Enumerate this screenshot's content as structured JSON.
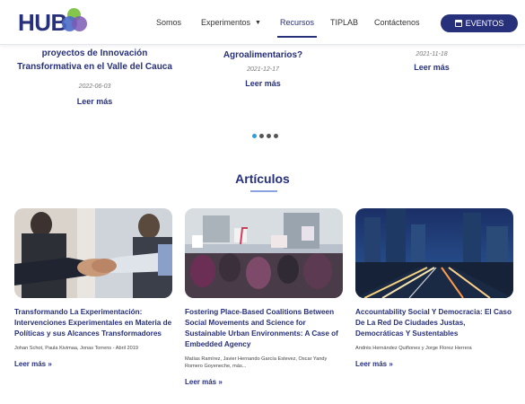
{
  "header": {
    "logo_text": "HUB",
    "nav": [
      {
        "label": "Somos"
      },
      {
        "label": "Experimentos"
      },
      {
        "label": "Recursos"
      },
      {
        "label": "TIPLAB"
      },
      {
        "label": "Contáctenos"
      }
    ],
    "active_nav": "Recursos",
    "events_button": "EVENTOS",
    "colors": {
      "brand": "#27307a",
      "active_dot": "#2e9fd8"
    }
  },
  "carousel": {
    "slides": [
      {
        "title_line1": "proyectos de Innovación",
        "title_line2": "Transformativa en el Valle del Cauca",
        "date": "2022-06-03",
        "more": "Leer más"
      },
      {
        "title_line1": "Agroalimentarios?",
        "date": "2021-12-17",
        "more": "Leer más"
      },
      {
        "date": "2021-11-18",
        "more": "Leer más"
      }
    ],
    "dots": 4,
    "active_dot": 1
  },
  "section": {
    "title": "Artículos"
  },
  "articles": [
    {
      "title": "Transformando La Experimentación: Intervenciones Experimentales en Materia de Políticas y sus Alcances Transformadores",
      "authors": "Johan Schot, Paula Kivimaa, Jonas Torrens - Abril 2019",
      "more": "Leer más »",
      "image": "handshake-photo"
    },
    {
      "title": "Fostering Place-Based Coalitions Between Social Movements and Science for Sustainable Urban Environments: A Case of Embedded Agency",
      "authors": "Matías Ramírez, Javier Hernando García Estevez, Oscar Yandy Romero Goyeneche, más...",
      "more": "Leer más »",
      "image": "protest-photo"
    },
    {
      "title": "Accountability Social Y Democracia: El Caso De La Red De Ciudades Justas, Democráticas Y Sustentables",
      "authors": "Andrés Hernández Quiñones y Jorge Florez Herrera",
      "more": "Leer más »",
      "image": "city-night-photo"
    }
  ]
}
